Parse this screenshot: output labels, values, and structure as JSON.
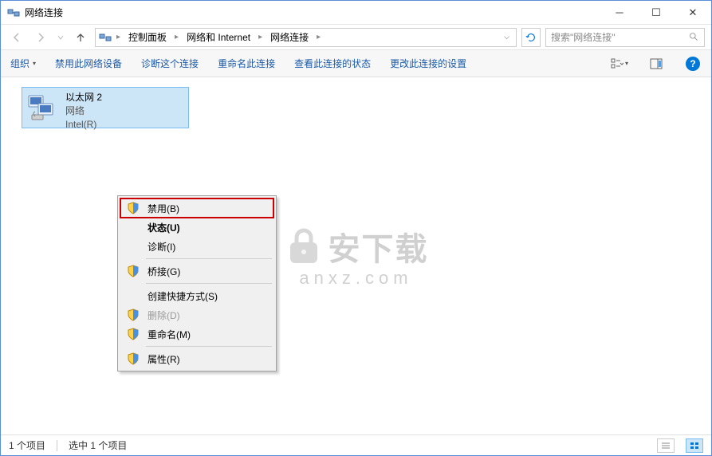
{
  "window": {
    "title": "网络连接"
  },
  "breadcrumb": {
    "items": [
      "控制面板",
      "网络和 Internet",
      "网络连接"
    ]
  },
  "search": {
    "placeholder": "搜索\"网络连接\""
  },
  "toolbar": {
    "organize": "组织",
    "items": [
      "禁用此网络设备",
      "诊断这个连接",
      "重命名此连接",
      "查看此连接的状态",
      "更改此连接的设置"
    ]
  },
  "connection": {
    "name": "以太网 2",
    "network": "网络",
    "adapter": "Intel(R)"
  },
  "context_menu": {
    "disable": "禁用(B)",
    "status": "状态(U)",
    "diagnose": "诊断(I)",
    "bridge": "桥接(G)",
    "shortcut": "创建快捷方式(S)",
    "delete": "删除(D)",
    "rename": "重命名(M)",
    "properties": "属性(R)"
  },
  "statusbar": {
    "count": "1 个项目",
    "selected": "选中 1 个项目"
  },
  "watermark": {
    "main": "安下载",
    "sub": "anxz.com"
  }
}
